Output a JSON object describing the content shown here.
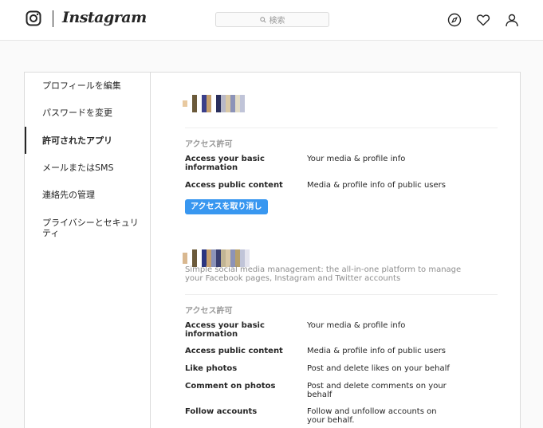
{
  "header": {
    "brand": "Instagram",
    "search_placeholder": "検索"
  },
  "sidebar": {
    "items": [
      {
        "label": "プロフィールを編集",
        "active": false
      },
      {
        "label": "パスワードを変更",
        "active": false
      },
      {
        "label": "許可されたアプリ",
        "active": true
      },
      {
        "label": "メールまたはSMS",
        "active": false
      },
      {
        "label": "連絡先の管理",
        "active": false
      },
      {
        "label": "プライバシーとセキュリティ",
        "active": false
      }
    ]
  },
  "apps": [
    {
      "section_label": "アクセス許可",
      "permissions": [
        {
          "name": "Access your basic information",
          "desc": "Your media & profile info"
        },
        {
          "name": "Access public content",
          "desc": "Media & profile info of public users"
        }
      ],
      "revoke_label": "アクセスを取り消し"
    },
    {
      "description": "Simple social media management: the all-in-one platform to manage your Facebook pages, Instagram and Twitter accounts",
      "section_label": "アクセス許可",
      "permissions": [
        {
          "name": "Access your basic information",
          "desc": "Your media & profile info"
        },
        {
          "name": "Access public content",
          "desc": "Media & profile info of public users"
        },
        {
          "name": "Like photos",
          "desc": "Post and delete likes on your behalf"
        },
        {
          "name": "Comment on photos",
          "desc": "Post and delete comments on your behalf"
        },
        {
          "name": "Follow accounts",
          "desc": "Follow and unfollow accounts on your behalf."
        }
      ]
    }
  ],
  "colors": {
    "accent": "#3897f0",
    "border": "#dbdbdb",
    "muted": "#999999"
  }
}
